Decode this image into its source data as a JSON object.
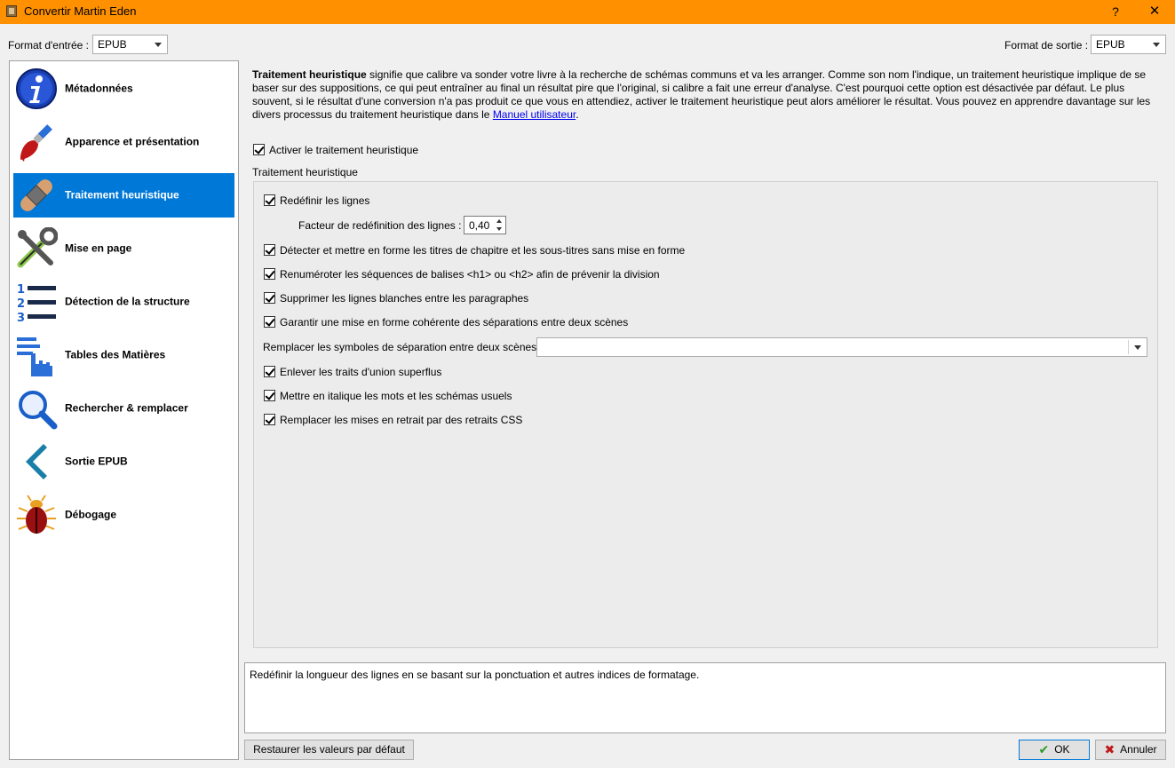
{
  "window": {
    "title": "Convertir Martin Eden",
    "help": "?",
    "close": "✕"
  },
  "input_format": {
    "label": "Format d'entrée :",
    "value": "EPUB"
  },
  "output_format": {
    "label": "Format de sortie :",
    "value": "EPUB"
  },
  "sidebar": {
    "items": [
      {
        "label": "Métadonnées",
        "icon": "info-icon"
      },
      {
        "label": "Apparence et présentation",
        "icon": "paintbrush-icon"
      },
      {
        "label": "Traitement heuristique",
        "icon": "bandage-icon"
      },
      {
        "label": "Mise en page",
        "icon": "tools-icon"
      },
      {
        "label": "Détection de la structure",
        "icon": "numbered-list-icon"
      },
      {
        "label": "Tables des Matières",
        "icon": "toc-hand-icon"
      },
      {
        "label": "Rechercher & remplacer",
        "icon": "magnifier-icon"
      },
      {
        "label": "Sortie EPUB",
        "icon": "chevron-left-icon"
      },
      {
        "label": "Débogage",
        "icon": "bug-icon"
      }
    ],
    "selected_index": 2
  },
  "description": {
    "bold": "Traitement heuristique",
    "text": " signifie que calibre va sonder votre livre à la recherche de schémas communs et va les arranger. Comme son nom l'indique, un traitement heuristique implique de se baser sur des suppositions, ce qui peut entraîner au final un résultat pire que l'original, si calibre a fait une erreur d'analyse. C'est pourquoi cette option est désactivée par défaut. Le plus souvent, si le résultat d'une conversion n'a pas produit ce que vous en attendiez, activer le traitement heuristique peut alors améliorer le résultat. Vous pouvez en apprendre davantage sur les divers processus du traitement heuristique dans le ",
    "link": "Manuel utilisateur",
    "end": "."
  },
  "enable_heuristics": {
    "label": "Activer le traitement heuristique",
    "checked": true
  },
  "group_title": "Traitement heuristique",
  "options": {
    "unwrap": {
      "label": "Redéfinir les lignes",
      "checked": true
    },
    "unwrap_factor": {
      "label": "Facteur de redéfinition des lignes :",
      "value": "0,40"
    },
    "headings": {
      "label": "Détecter et mettre en forme les titres de chapitre et les sous-titres sans mise en forme",
      "checked": true
    },
    "renumber": {
      "label": "Renuméroter les séquences de balises <h1> ou <h2> afin de prévenir la division",
      "checked": true
    },
    "blank_lines": {
      "label": "Supprimer les lignes blanches entre les paragraphes",
      "checked": true
    },
    "scene_breaks": {
      "label": "Garantir une mise en forme cohérente des séparations entre deux scènes",
      "checked": true
    },
    "replace_scene": {
      "label": "Remplacer les symboles de séparation entre deux scènes :",
      "value": ""
    },
    "hyphens": {
      "label": "Enlever les traits d'union superflus",
      "checked": true
    },
    "italicize": {
      "label": "Mettre en italique les mots et les schémas usuels",
      "checked": true
    },
    "indents": {
      "label": "Remplacer les mises en retrait par des retraits CSS",
      "checked": true
    }
  },
  "help_text": "Redéfinir la longueur des lignes en se basant sur la ponctuation et autres indices de formatage.",
  "buttons": {
    "restore": "Restaurer les valeurs par défaut",
    "ok": "OK",
    "cancel": "Annuler"
  }
}
